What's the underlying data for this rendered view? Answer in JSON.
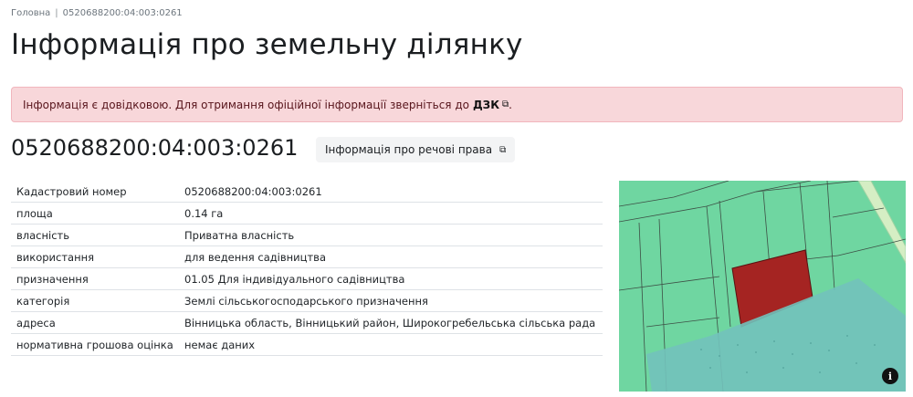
{
  "breadcrumb": {
    "home": "Головна",
    "separator": "|",
    "current": "0520688200:04:003:0261"
  },
  "page": {
    "title": "Інформація про земельну ділянку"
  },
  "alert": {
    "text": "Інформація є довідковою. Для отримання офіційної інформації зверніться до",
    "link": "ДЗК",
    "link_icon": "external-link-icon",
    "suffix": "."
  },
  "parcel": {
    "cadastral_number": "0520688200:04:003:0261",
    "rights_button": "Інформація про речові права",
    "rights_icon": "external-link-icon"
  },
  "table": {
    "rows": [
      {
        "key": "Кадастровий номер",
        "value": "0520688200:04:003:0261"
      },
      {
        "key": "площа",
        "value": "0.14 га"
      },
      {
        "key": "власність",
        "value": "Приватна власність"
      },
      {
        "key": "використання",
        "value": "для ведення садівництва"
      },
      {
        "key": "призначення",
        "value": "01.05 Для індивідуального садівництва"
      },
      {
        "key": "категорія",
        "value": "Землі сільськогосподарського призначення"
      },
      {
        "key": "адреса",
        "value": "Вінницька область, Вінницький район, Широкогребельська сільська рада"
      },
      {
        "key": "нормативна грошова оцінка",
        "value": "немає даних"
      }
    ]
  },
  "map": {
    "info_icon": "info-icon",
    "info_glyph": "i",
    "colors": {
      "land": "#6fd6a1",
      "overlay": "#72c2bb",
      "parcel": "#a52422",
      "road": "#d5eec4"
    }
  }
}
